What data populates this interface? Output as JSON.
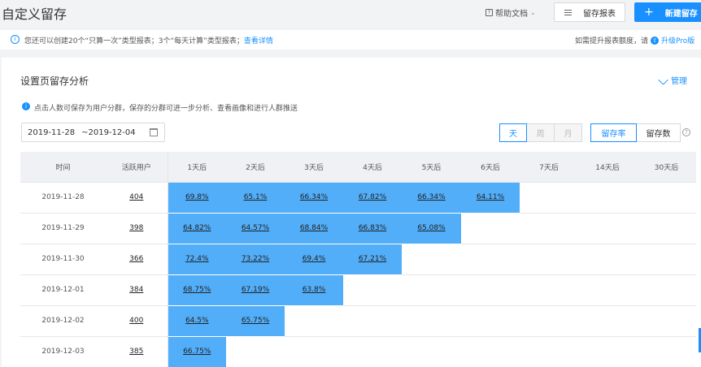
{
  "header": {
    "title": "自定义留存",
    "help": "帮助文档",
    "report_button": "留存报表",
    "new_button": "新建留存"
  },
  "notice": {
    "text": "您还可以创建20个“只算一次”类型报表；3个“每天计算”类型报表；",
    "link": "查看详情",
    "right_text": "如需提升报表额度，请",
    "upgrade": "升级Pro版"
  },
  "panel": {
    "title": "设置页留存分析",
    "manage": "管理",
    "hint": "点击人数可保存为用户分群，保存的分群可进一步分析、查看画像和进行人群推送"
  },
  "filters": {
    "start_date": "2019-11-28",
    "end_date": "~2019-12-04",
    "period": {
      "day": "天",
      "week": "周",
      "month": "月",
      "selected": "day"
    },
    "metric": {
      "rate": "留存率",
      "count": "留存数",
      "selected": "rate"
    }
  },
  "table": {
    "headers": [
      "时间",
      "活跃用户",
      "1天后",
      "2天后",
      "3天后",
      "4天后",
      "5天后",
      "6天后",
      "7天后",
      "14天后",
      "30天后"
    ],
    "rows": [
      {
        "date": "2019-11-28",
        "users": "404",
        "values": [
          "69.8%",
          "65.1%",
          "66.34%",
          "67.82%",
          "66.34%",
          "64.11%",
          "",
          "",
          ""
        ]
      },
      {
        "date": "2019-11-29",
        "users": "398",
        "values": [
          "64.82%",
          "64.57%",
          "68.84%",
          "66.83%",
          "65.08%",
          "",
          "",
          "",
          ""
        ]
      },
      {
        "date": "2019-11-30",
        "users": "366",
        "values": [
          "72.4%",
          "73.22%",
          "69.4%",
          "67.21%",
          "",
          "",
          "",
          "",
          ""
        ]
      },
      {
        "date": "2019-12-01",
        "users": "384",
        "values": [
          "68.75%",
          "67.19%",
          "63.8%",
          "",
          "",
          "",
          "",
          "",
          ""
        ]
      },
      {
        "date": "2019-12-02",
        "users": "400",
        "values": [
          "64.5%",
          "65.75%",
          "",
          "",
          "",
          "",
          "",
          "",
          ""
        ]
      },
      {
        "date": "2019-12-03",
        "users": "385",
        "values": [
          "66.75%",
          "",
          "",
          "",
          "",
          "",
          "",
          "",
          ""
        ]
      }
    ]
  },
  "colors": {
    "accent": "#1890ff",
    "cell_fill": "#52aef9"
  }
}
